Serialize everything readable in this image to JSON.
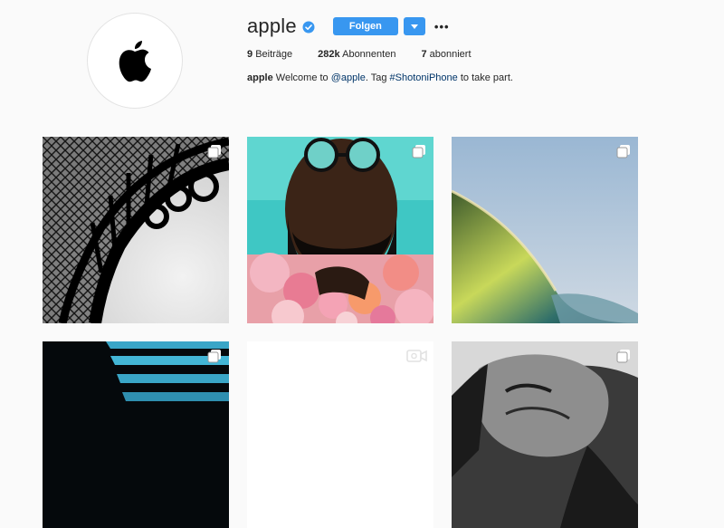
{
  "profile": {
    "username": "apple",
    "follow_label": "Folgen",
    "more_label": "•••",
    "stats": {
      "posts_count": "9",
      "posts_label": "Beiträge",
      "followers_count": "282k",
      "followers_label": "Abonnenten",
      "following_count": "7",
      "following_label": "abonniert"
    },
    "bio": {
      "name": "apple",
      "text_1": "Welcome to",
      "mention": "@apple",
      "text_2": ". Tag",
      "hashtag": "#ShotoniPhone",
      "text_3": "to take part."
    }
  },
  "icons": {
    "avatar": "apple-logo-icon",
    "verified": "verified-badge-icon",
    "dropdown": "caret-down-icon",
    "multi": "multiple-photos-icon",
    "video": "video-icon"
  },
  "colors": {
    "accent": "#3897f0",
    "link": "#003569",
    "background": "#fafafa",
    "text": "#262626"
  },
  "posts": [
    {
      "subject": "eiffel-tower",
      "badge": "multiple-photos-icon"
    },
    {
      "subject": "bearded-man-with-flowers",
      "badge": "multiple-photos-icon"
    },
    {
      "subject": "ocean-wave",
      "badge": "multiple-photos-icon"
    },
    {
      "subject": "blue-stripes",
      "badge": "multiple-photos-icon"
    },
    {
      "subject": "white-image",
      "badge": "video-icon"
    },
    {
      "subject": "woman-portrait",
      "badge": "multiple-photos-icon"
    }
  ]
}
